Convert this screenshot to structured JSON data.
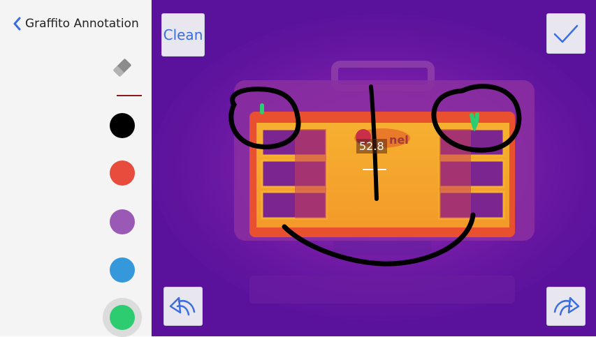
{
  "header": {
    "title": "Graffito Annotation"
  },
  "toolbar": {
    "clean_label": "Clean",
    "confirm_icon": "check-icon",
    "undo_icon": "undo-icon",
    "redo_icon": "redo-icon"
  },
  "tools": {
    "eraser_icon": "eraser-icon",
    "stroke_color": "#8b1a1a"
  },
  "palette": {
    "colors": [
      "#000000",
      "#e74c3c",
      "#9b59b6",
      "#3498db",
      "#2ecc71"
    ],
    "selected": "#2ecc71"
  },
  "image": {
    "temperature_reading": "52.8"
  }
}
